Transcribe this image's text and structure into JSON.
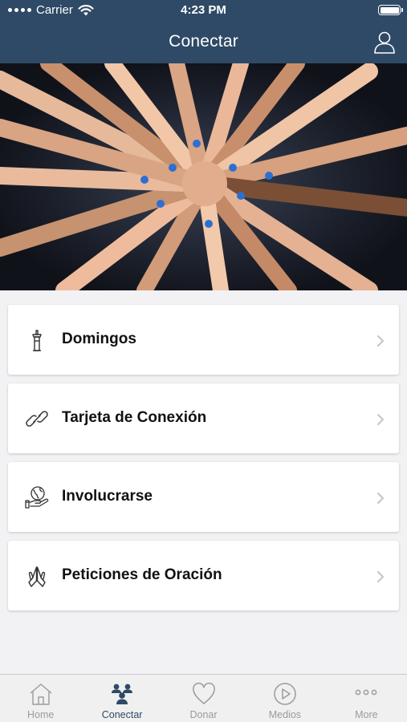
{
  "status_bar": {
    "carrier": "Carrier",
    "time": "4:23 PM"
  },
  "nav": {
    "title": "Conectar",
    "profile_icon": "user-icon"
  },
  "hero": {
    "image_icon": "hands-together-photo"
  },
  "menu": [
    {
      "label": "Domingos",
      "icon": "pulpit-icon"
    },
    {
      "label": "Tarjeta de Conexión",
      "icon": "link-icon"
    },
    {
      "label": "Involucrarse",
      "icon": "globe-hand-icon"
    },
    {
      "label": "Peticiones de Oración",
      "icon": "praying-hands-icon"
    }
  ],
  "tabs": [
    {
      "label": "Home",
      "icon": "home-icon",
      "active": false
    },
    {
      "label": "Conectar",
      "icon": "group-icon",
      "active": true
    },
    {
      "label": "Donar",
      "icon": "heart-icon",
      "active": false
    },
    {
      "label": "Medios",
      "icon": "play-icon",
      "active": false
    },
    {
      "label": "More",
      "icon": "more-icon",
      "active": false
    }
  ],
  "colors": {
    "header": "#2f4a66",
    "active_tab": "#2f4a66",
    "inactive_tab": "#9b9ba0",
    "background": "#f2f2f4"
  }
}
